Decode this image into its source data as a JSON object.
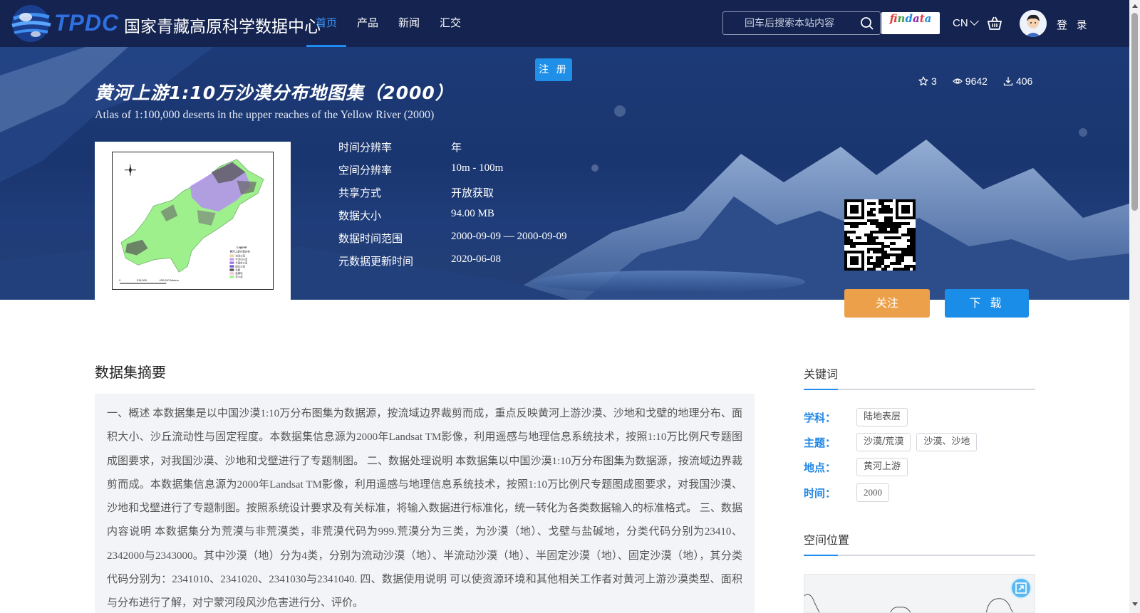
{
  "header": {
    "logo_text": "TPDC",
    "site_name": "国家青藏高原科学数据中心",
    "nav": [
      {
        "label": "首页"
      },
      {
        "label": "产品"
      },
      {
        "label": "新闻"
      },
      {
        "label": "汇交"
      }
    ],
    "search_placeholder": "回车后搜索本站内容",
    "findata_letters": [
      "f",
      "i",
      "n",
      "d",
      "a",
      "t",
      "a"
    ],
    "lang": "CN",
    "login": "登 录",
    "register": "注 册"
  },
  "dataset": {
    "title": "黄河上游1:10万沙漠分布地图集（2000）",
    "subtitle": "Atlas of 1:100,000 deserts in the upper reaches of the Yellow River (2000)",
    "stars": "3",
    "views": "9642",
    "downloads": "406",
    "meta": [
      {
        "key": "时间分辨率",
        "value": "年"
      },
      {
        "key": "空间分辨率",
        "value": "10m - 100m"
      },
      {
        "key": "共享方式",
        "value": "开放获取"
      },
      {
        "key": "数据大小",
        "value": "94.00 MB"
      },
      {
        "key": "数据时间范围",
        "value": "2000-09-09 — 2000-09-09"
      },
      {
        "key": "元数据更新时间",
        "value": "2020-06-08"
      }
    ],
    "follow_button": "关注",
    "download_button": "下 载",
    "thumbnail_legend": {
      "title": "Legend",
      "subtitle": "黄河上游沙漠分布",
      "items": [
        "流动沙漠",
        "半流动沙漠",
        "半固定沙漠",
        "固定沙漠",
        "戈壁",
        "盐碱地",
        "非沙漠"
      ],
      "scale": [
        "0",
        "215,000",
        "430,000 Meters"
      ]
    }
  },
  "abstract": {
    "title": "数据集摘要",
    "text": "一、概述 本数据集是以中国沙漠1:10万分布图集为数据源，按流域边界裁剪而成，重点反映黄河上游沙漠、沙地和戈壁的地理分布、面积大小、沙丘流动性与固定程度。本数据集信息源为2000年Landsat TM影像，利用遥感与地理信息系统技术，按照1:10万比例尺专题图成图要求，对我国沙漠、沙地和戈壁进行了专题制图。 二、数据处理说明 本数据集以中国沙漠1:10万分布图集为数据源，按流域边界裁剪而成。本数据集信息源为2000年Landsat TM影像，利用遥感与地理信息系统技术，按照1:10万比例尺专题图成图要求，对我国沙漠、沙地和戈壁进行了专题制图。按照系统设计要求及有关标准，将输入数据进行标准化，统一转化为各类数据输入的标准格式。 三、数据内容说明 本数据集分为荒漠与非荒漠类，非荒漠代码为999.荒漠分为三类，为沙漠（地）、戈壁与盐碱地，分类代码分别为23410、2342000与2343000。其中沙漠（地）分为4类，分别为流动沙漠（地）、半流动沙漠（地）、半固定沙漠（地）、固定沙漠（地），其分类代码分别为：2341010、2341020、2341030与2341040. 四、数据使用说明 可以使资源环境和其他相关工作者对黄河上游沙漠类型、面积与分布进行了解，对宁蒙河段风沙危害进行分、评价。"
  },
  "keywords": {
    "title": "关键词",
    "rows": [
      {
        "label": "学科：",
        "tags": [
          "陆地表层"
        ]
      },
      {
        "label": "主题：",
        "tags": [
          "沙漠/荒漠",
          "沙漠、沙地"
        ]
      },
      {
        "label": "地点：",
        "tags": [
          "黄河上游"
        ]
      },
      {
        "label": "时间：",
        "tags": [
          "2000"
        ]
      }
    ]
  },
  "spatial": {
    "title": "空间位置"
  },
  "colors": {
    "nav_bg": "#14234f",
    "accent": "#1e8cf0",
    "follow": "#eda04a",
    "download": "#1a8de9"
  }
}
